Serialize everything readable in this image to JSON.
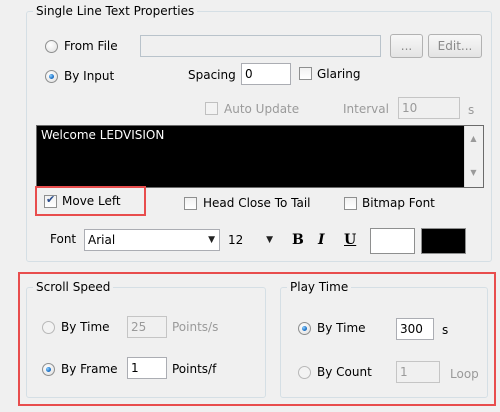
{
  "single_line": {
    "legend": "Single Line Text Properties",
    "from_file_label": "From File",
    "from_file_path": "",
    "browse_label": "...",
    "edit_label": "Edit...",
    "by_input_label": "By Input",
    "spacing_label": "Spacing",
    "spacing_value": "0",
    "glaring_label": "Glaring",
    "auto_update_label": "Auto Update",
    "interval_label": "Interval",
    "interval_value": "10",
    "interval_unit": "s",
    "text_content": "Welcome LEDVISION",
    "move_left_label": "Move Left",
    "head_close_label": "Head Close To Tail",
    "bitmap_font_label": "Bitmap Font",
    "font_label": "Font",
    "font_value": "Arial",
    "size_value": "12",
    "bold_glyph": "B",
    "italic_glyph": "I",
    "underline_glyph": "U",
    "fore_color": "#ffffff",
    "back_color": "#000000"
  },
  "scroll_speed": {
    "legend": "Scroll Speed",
    "by_time_label": "By Time",
    "by_time_value": "25",
    "by_time_unit": "Points/s",
    "by_frame_label": "By Frame",
    "by_frame_value": "1",
    "by_frame_unit": "Points/f"
  },
  "play_time": {
    "legend": "Play Time",
    "by_time_label": "By Time",
    "by_time_value": "300",
    "by_time_unit": "s",
    "by_count_label": "By Count",
    "by_count_value": "1",
    "by_count_unit": "Loop"
  },
  "highlight_color": "#e84d4d"
}
